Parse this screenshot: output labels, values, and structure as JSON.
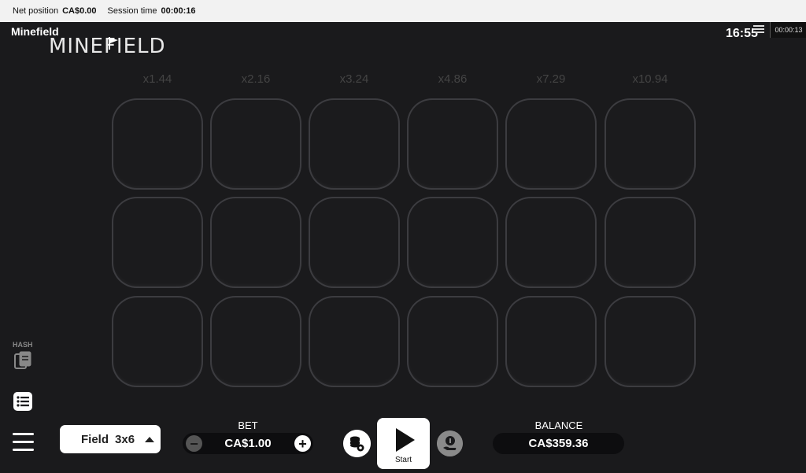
{
  "topbar": {
    "net_position_label": "Net position",
    "net_position_value": "CA$0.00",
    "session_time_label": "Session time",
    "session_time_value": "00:00:16"
  },
  "header": {
    "game_name": "Minefield",
    "logo_text": "MINEFIELD",
    "clock": "16:55",
    "timer": "00:00:13"
  },
  "board": {
    "multipliers": [
      "x1.44",
      "x2.16",
      "x3.24",
      "x4.86",
      "x7.29",
      "x10.94"
    ],
    "rows": 3,
    "cols": 6
  },
  "left_controls": {
    "hash_label": "HASH"
  },
  "field_select": {
    "label": "Field",
    "value": "3x6"
  },
  "bet": {
    "label": "BET",
    "value": "CA$1.00"
  },
  "start": {
    "label": "Start"
  },
  "balance": {
    "label": "BALANCE",
    "value": "CA$359.36"
  },
  "colors": {
    "background": "#1a1a1c",
    "tile_border": "#3c3c40",
    "multiplier_text": "#444444"
  }
}
